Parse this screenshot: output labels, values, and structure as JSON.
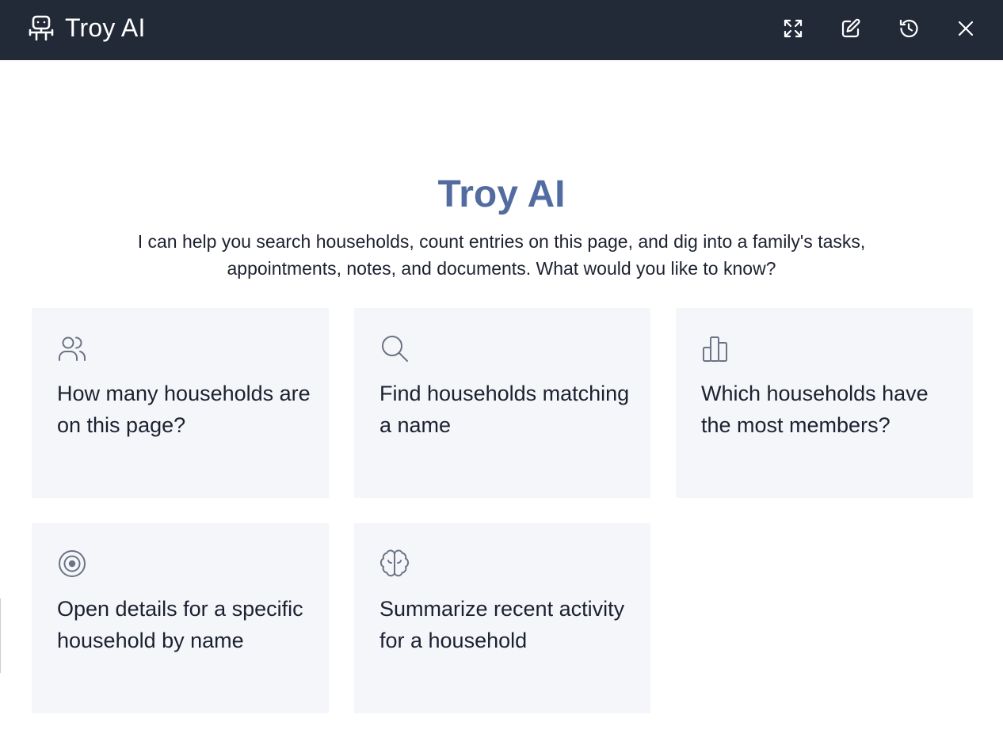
{
  "header": {
    "app_title": "Troy AI",
    "brand_icon": "robot-icon",
    "actions": [
      {
        "name": "expand",
        "icon": "expand-icon"
      },
      {
        "name": "new-chat",
        "icon": "edit-icon"
      },
      {
        "name": "history",
        "icon": "history-icon"
      },
      {
        "name": "close",
        "icon": "close-icon"
      }
    ],
    "colors": {
      "background": "#222a38",
      "foreground": "#ffffff"
    }
  },
  "welcome": {
    "title": "Troy AI",
    "subtitle": "I can help you search households, count entries on this page, and dig into a family's tasks, appointments, notes, and documents. What would you like to know?"
  },
  "suggestions": [
    {
      "icon": "users-icon",
      "label": "How many households are on this page?"
    },
    {
      "icon": "search-icon",
      "label": "Find households matching a name"
    },
    {
      "icon": "bar-chart-icon",
      "label": "Which households have the most members?"
    },
    {
      "icon": "target-icon",
      "label": "Open details for a specific household by name"
    },
    {
      "icon": "brain-icon",
      "label": "Summarize recent activity for a household"
    }
  ],
  "colors": {
    "card_background": "#f4f6fa",
    "icon_stroke": "#6b7384",
    "title_gradient_start": "#5a6a8e",
    "title_gradient_end": "#4a6db3"
  }
}
